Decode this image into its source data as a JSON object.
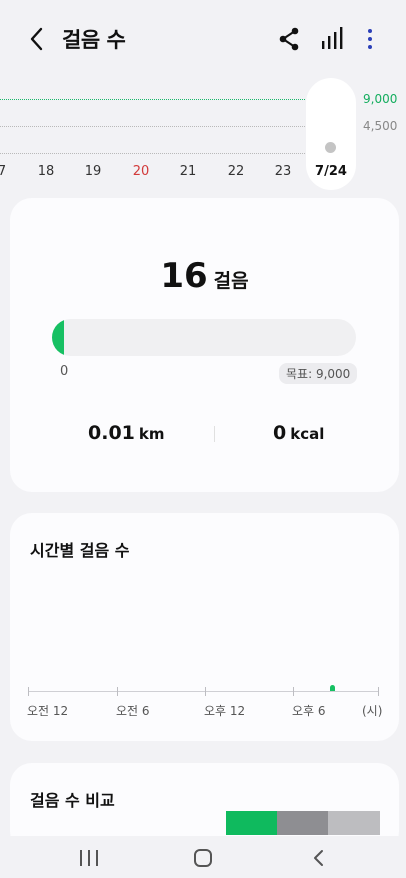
{
  "header": {
    "title": "걸음 수",
    "back_icon": "chevron-left-icon",
    "share_icon": "share-icon",
    "chart_icon": "bar-chart-icon",
    "more_icon": "more-vertical-icon"
  },
  "mini_chart": {
    "goal_label": "9,000",
    "half_label": "4,500",
    "days": [
      {
        "label": "7",
        "highlight": false
      },
      {
        "label": "18",
        "highlight": false
      },
      {
        "label": "19",
        "highlight": false
      },
      {
        "label": "20",
        "highlight": true
      },
      {
        "label": "21",
        "highlight": false
      },
      {
        "label": "22",
        "highlight": false
      },
      {
        "label": "23",
        "highlight": false
      }
    ],
    "selected_day": "7/24"
  },
  "summary": {
    "steps_value": "16",
    "steps_unit": "걸음",
    "progress_fraction": 0.0018,
    "progress_start": "0",
    "goal_label": "목표: 9,000",
    "distance_value": "0.01",
    "distance_unit": "km",
    "calories_value": "0",
    "calories_unit": "kcal"
  },
  "hourly": {
    "title": "시간별 걸음 수",
    "axis_labels": [
      "오전 12",
      "오전 6",
      "오후 12",
      "오후 6"
    ],
    "axis_unit": "(시)"
  },
  "compare": {
    "title": "걸음 수 비교"
  },
  "colors": {
    "accent_green": "#17c063",
    "sunday_red": "#d23a3a",
    "more_blue": "#2b3fb8"
  },
  "navbar": {
    "recents_icon": "recents-icon",
    "home_icon": "home-icon",
    "back_icon": "nav-back-icon"
  }
}
